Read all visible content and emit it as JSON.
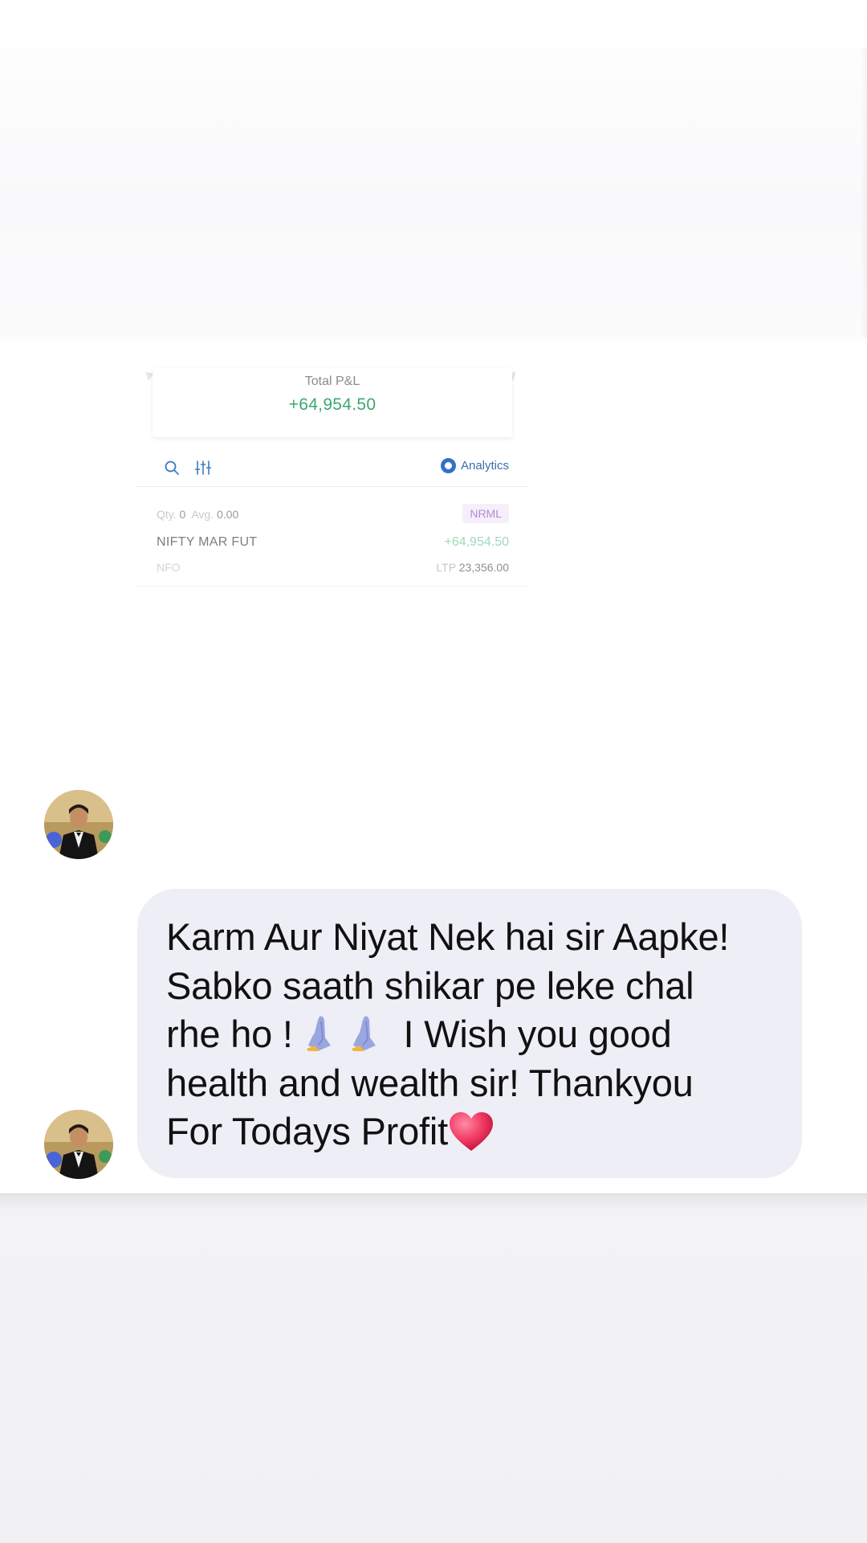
{
  "pnl_card": {
    "label": "Total P&L",
    "value": "+64,954.50"
  },
  "toolbar": {
    "search_icon": "search-icon",
    "filter_icon": "filter-sliders-icon",
    "analytics_label": "Analytics"
  },
  "position": {
    "qty_label": "Qty.",
    "qty_value": "0",
    "avg_label": "Avg.",
    "avg_value": "0.00",
    "product_tag": "NRML",
    "symbol": "NIFTY MAR FUT",
    "pnl": "+64,954.50",
    "exchange": "NFO",
    "ltp_label": "LTP",
    "ltp_value": "23,356.00"
  },
  "message": {
    "line1": "Karm Aur Niyat Nek hai sir Aapke!",
    "line2": "Sabko saath shikar pe leke chal",
    "line3_start": "rhe ho !",
    "line3_end": "I Wish you good",
    "line4": "health and wealth sir! Thankyou",
    "line5": "For Todays Profit"
  },
  "colors": {
    "profit_green": "#3aa86d",
    "bubble_bg": "#eeeff6",
    "analytics_blue": "#2f72c8",
    "heart_red": "#e8294a"
  }
}
